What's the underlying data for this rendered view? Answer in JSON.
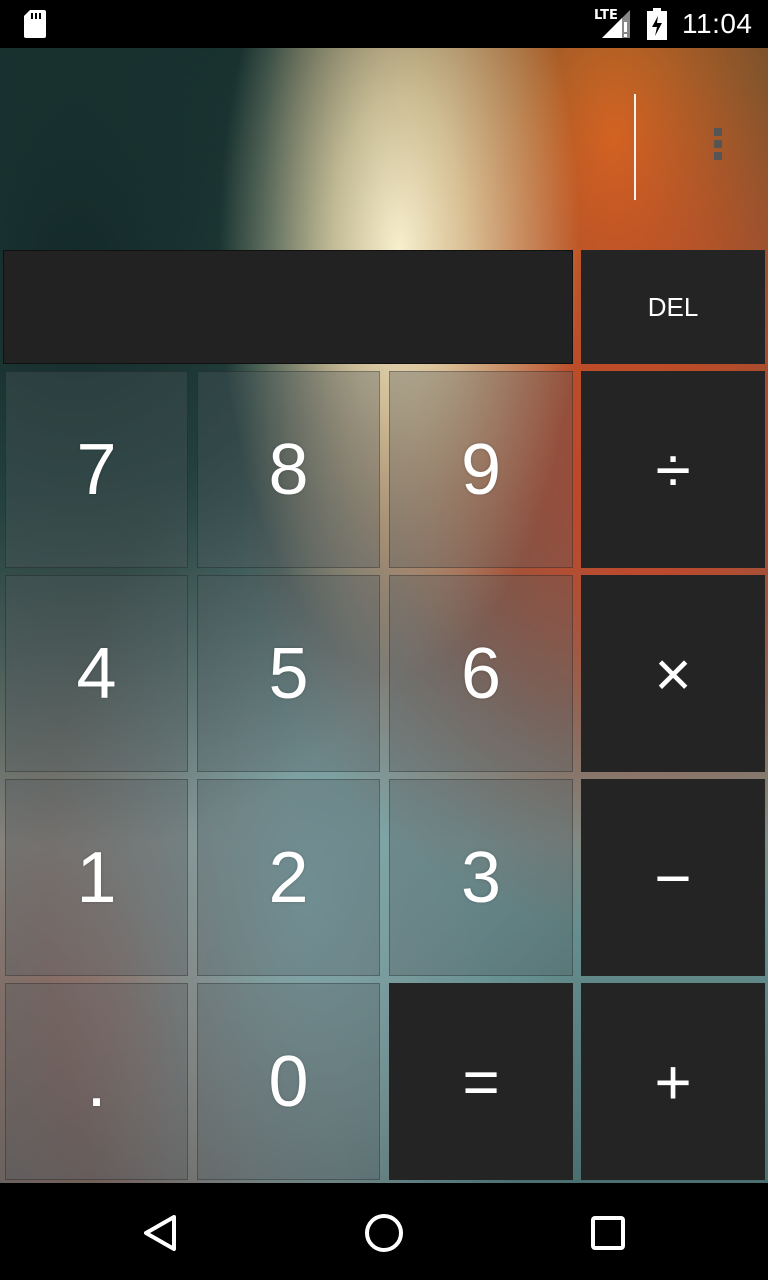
{
  "status_bar": {
    "network": "LTE",
    "time": "11:04"
  },
  "display": {
    "expression": ""
  },
  "buttons": {
    "del": "DEL",
    "seven": "7",
    "eight": "8",
    "nine": "9",
    "divide": "÷",
    "four": "4",
    "five": "5",
    "six": "6",
    "multiply": "×",
    "one": "1",
    "two": "2",
    "three": "3",
    "minus": "−",
    "dot": ".",
    "zero": "0",
    "equals": "=",
    "plus": "+"
  },
  "icons": {
    "sd": "sd-card-icon",
    "signal": "signal-icon",
    "battery": "battery-charging-icon",
    "menu": "overflow-menu-icon",
    "back": "back-icon",
    "home": "home-icon",
    "recents": "recents-icon"
  },
  "colors": {
    "operator_bg": "#242424",
    "display_bg": "#222222",
    "text": "#ffffff"
  }
}
